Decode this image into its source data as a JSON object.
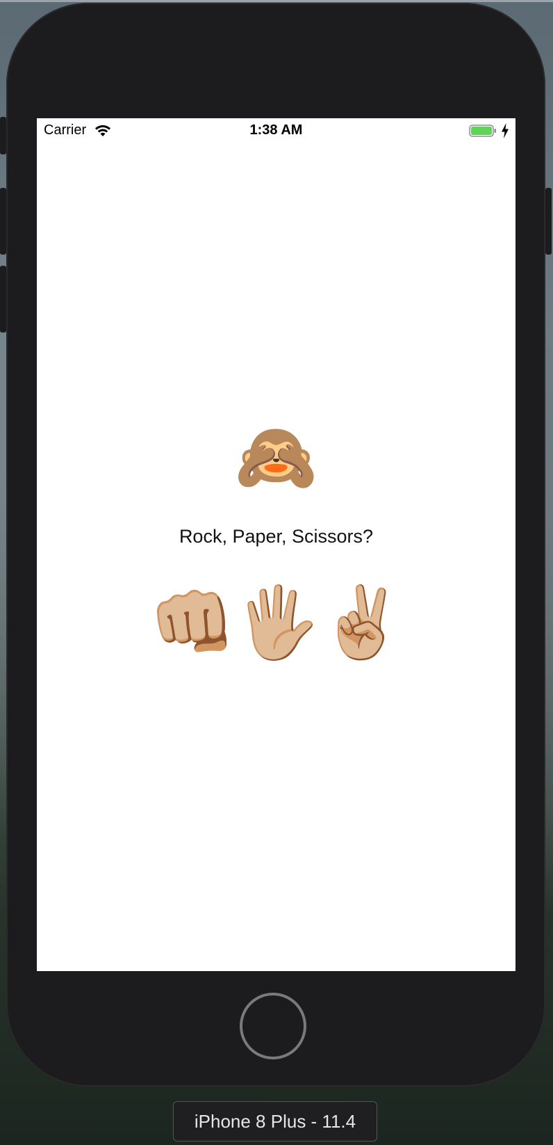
{
  "status_bar": {
    "carrier": "Carrier",
    "time": "1:38 AM",
    "wifi_icon": "wifi-icon",
    "battery_icon": "battery-icon",
    "charging_icon": "charging-bolt-icon",
    "battery_color": "#5fd35a"
  },
  "app": {
    "status_emoji": "🙈",
    "prompt": "Rock, Paper, Scissors?",
    "choices": [
      {
        "emoji": "👊🏼",
        "icon": "rock-fist-icon"
      },
      {
        "emoji": "🖐🏼",
        "icon": "paper-hand-icon"
      },
      {
        "emoji": "✌🏼",
        "icon": "scissors-peace-icon"
      }
    ]
  },
  "simulator": {
    "device_label": "iPhone 8 Plus - 11.4"
  }
}
